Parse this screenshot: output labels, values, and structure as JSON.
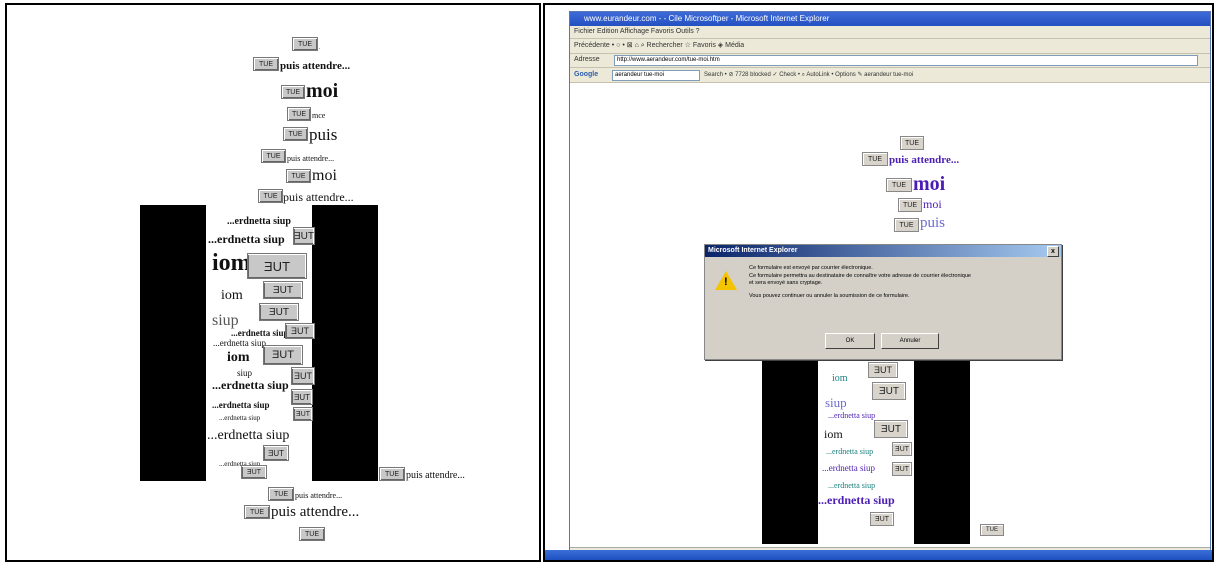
{
  "button_label": "TUE",
  "button_mirrored": "TUE",
  "phrases": {
    "wait": "puis attendre...",
    "me": "moi",
    "then": "puis",
    "me_small": "mce",
    "mirror_me": "iom",
    "mirror_then": "siup",
    "mirror_wait": "...erdnetta siup"
  },
  "ie": {
    "title": "www.eurandeur.com - - Cile Microsoftper - Microsoft Internet Explorer",
    "menu": "Fichier   Edition   Affichage   Favoris   Outils   ?",
    "toolbar": "Précédente  •  ○  •  ⊠  ⌂   ⌕ Rechercher   ☆ Favoris   ◈ Média",
    "address_label": "Adresse",
    "address_value": "http://www.aerandeur.com/tue-moi.htm",
    "google_label": "Google",
    "google_value": "aerandeur tue-moi",
    "google_tools": "Search  •  ⊘ 7728 blocked   ✓ Check  •  ⌕ AutoLink  •  Options  ✎  aerandeur  tue-moi"
  },
  "dialog": {
    "title": "Microsoft Internet Explorer",
    "close": "x",
    "line1": "Ce formulaire est envoyé par courrier électronique.",
    "line2": "Ce formulaire permettra au destinataire de connaître votre adresse de courrier électronique",
    "line3": "et sera envoyé sans cryptage.",
    "line4": "Vous pouvez continuer ou annuler la soumission de ce formulaire.",
    "ok": "OK",
    "cancel": "Annuler"
  },
  "colors": {
    "button_face": "#c8c8c8",
    "block": "#000000",
    "link_purple": "#4b1db3",
    "dialog_face": "#d4d0c8"
  }
}
